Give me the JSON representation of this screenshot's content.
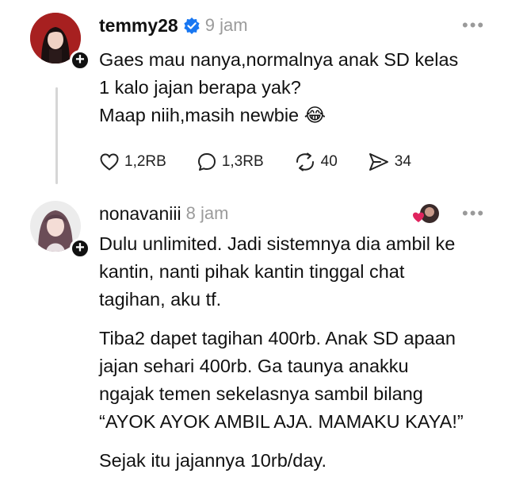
{
  "posts": [
    {
      "username": "temmy28",
      "time": "9 jam",
      "more": "•••",
      "lines": [
        "Gaes mau nanya,normalnya anak SD kelas",
        "1 kalo jajan berapa yak?",
        "Maap niih,masih newbie 😂"
      ],
      "actions": {
        "likes": "1,2RB",
        "replies": "1,3RB",
        "reposts": "40",
        "shares": "34"
      }
    },
    {
      "username": "nonavaniii",
      "time": "8 jam",
      "more": "•••",
      "paragraphs": [
        [
          "Dulu unlimited. Jadi sistemnya dia ambil ke",
          "kantin, nanti pihak kantin tinggal chat",
          "tagihan, aku tf."
        ],
        [
          "Tiba2 dapet tagihan 400rb. Anak SD apaan",
          "jajan sehari 400rb. Ga taunya anakku",
          "ngajak temen sekelasnya sambil bilang",
          "“AYOK AYOK AMBIL AJA. MAMAKU KAYA!”"
        ],
        [
          "Sejak itu jajannya 10rb/day."
        ]
      ]
    }
  ],
  "colors": {
    "verified": "#1877f2",
    "muted": "#9b9b9b",
    "react": "#e0245e"
  },
  "icons": {
    "like": "heart-icon",
    "reply": "comment-bubble-icon",
    "repost": "repost-icon",
    "share": "send-icon",
    "verified": "verified-badge-icon",
    "follow": "plus-icon",
    "reaction": "heart-reaction-icon"
  }
}
